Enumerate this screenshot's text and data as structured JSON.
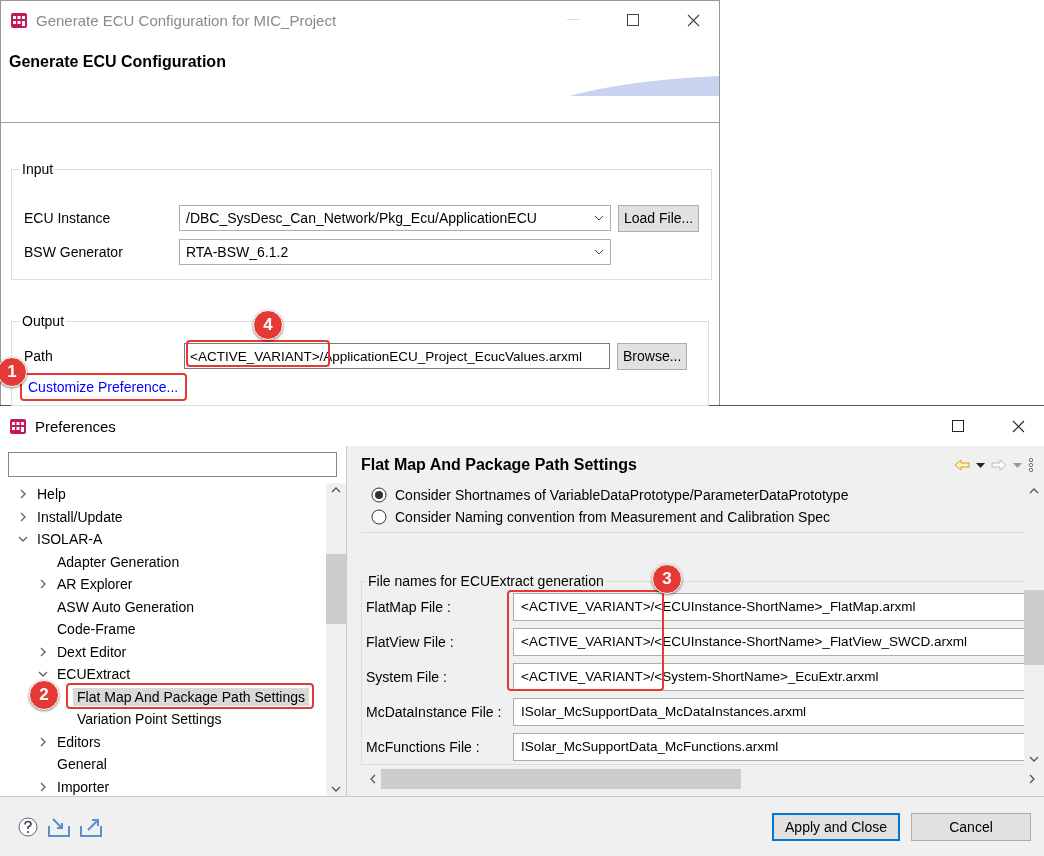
{
  "main_window": {
    "title": "Generate ECU Configuration for MIC_Project",
    "heading": "Generate ECU Configuration",
    "input": {
      "legend": "Input",
      "rows": [
        {
          "label": "ECU Instance",
          "value": "/DBC_SysDesc_Can_Network/Pkg_Ecu/ApplicationECU",
          "button": "Load File..."
        },
        {
          "label": "BSW Generator",
          "value": "RTA-BSW_6.1.2"
        }
      ]
    },
    "output": {
      "legend": "Output",
      "path": {
        "label": "Path",
        "value": "<ACTIVE_VARIANT>/ApplicationECU_Project_EcucValues.arxml",
        "button": "Browse..."
      },
      "link": "Customize Preference..."
    }
  },
  "preferences": {
    "title": "Preferences",
    "tree": [
      {
        "label": "Help",
        "expanded": false,
        "selected": false
      },
      {
        "label": "Install/Update",
        "expanded": false,
        "selected": false
      },
      {
        "label": "ISOLAR-A",
        "expanded": true,
        "selected": false,
        "children": [
          {
            "label": "Adapter Generation",
            "selected": false
          },
          {
            "label": "AR Explorer",
            "expanded": false,
            "selected": false
          },
          {
            "label": "ASW Auto Generation",
            "selected": false
          },
          {
            "label": "Code-Frame",
            "selected": false
          },
          {
            "label": "Dext Editor",
            "expanded": false,
            "selected": false
          },
          {
            "label": "ECUExtract",
            "expanded": true,
            "selected": false,
            "children": [
              {
                "label": "Flat Map And Package Path Settings",
                "selected": true
              },
              {
                "label": "Variation Point Settings",
                "selected": false
              }
            ]
          },
          {
            "label": "Editors",
            "expanded": false,
            "selected": false
          },
          {
            "label": "General",
            "selected": false
          },
          {
            "label": "Importer",
            "expanded": false,
            "selected": false
          }
        ]
      }
    ],
    "page": {
      "title": "Flat Map And Package Path Settings",
      "radios": [
        {
          "label": "Consider Shortnames of VariableDataPrototype/ParameterDataPrototype",
          "selected": true
        },
        {
          "label": "Consider Naming convention from Measurement and Calibration Spec",
          "selected": false
        }
      ],
      "file_group": {
        "legend": "File names for ECUExtract generation",
        "fields": [
          {
            "label": "FlatMap File :",
            "value": "<ACTIVE_VARIANT>/<ECUInstance-ShortName>_FlatMap.arxml"
          },
          {
            "label": "FlatView File :",
            "value": "<ACTIVE_VARIANT>/<ECUInstance-ShortName>_FlatView_SWCD.arxml"
          },
          {
            "label": "System File :",
            "value": "<ACTIVE_VARIANT>/<System-ShortName>_EcuExtr.arxml"
          },
          {
            "label": "McDataInstance File :",
            "value": "ISolar_McSupportData_McDataInstances.arxml"
          },
          {
            "label": "McFunctions File :",
            "value": "ISolar_McSupportData_McFunctions.arxml"
          }
        ]
      }
    },
    "buttons": [
      {
        "label": "Apply and Close",
        "default": true
      },
      {
        "label": "Cancel",
        "default": false
      }
    ]
  },
  "annotations": [
    {
      "number": "1"
    },
    {
      "number": "2"
    },
    {
      "number": "3"
    },
    {
      "number": "4"
    }
  ]
}
